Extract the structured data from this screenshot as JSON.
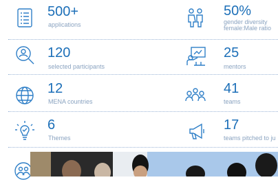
{
  "stats": [
    {
      "value": "500+",
      "label": "applications",
      "icon": "checklist-icon"
    },
    {
      "value": "50%",
      "label": "gender diversity",
      "label2": "female:Male ratio",
      "icon": "gender-icon"
    },
    {
      "value": "120",
      "label": "selected participants",
      "icon": "search-people-icon"
    },
    {
      "value": "25",
      "label": "mentors",
      "icon": "presentation-icon"
    },
    {
      "value": "12",
      "label": "MENA countries",
      "icon": "globe-icon"
    },
    {
      "value": "41",
      "label": "teams",
      "icon": "team-icon"
    },
    {
      "value": "6",
      "label": "Themes",
      "icon": "lightbulb-icon"
    },
    {
      "value": "17",
      "label": "teams pitched to ju",
      "icon": "megaphone-icon"
    }
  ],
  "colors": {
    "accent": "#1c6fb8",
    "label": "#8aa3c0",
    "icon": "#2f7fc7"
  }
}
